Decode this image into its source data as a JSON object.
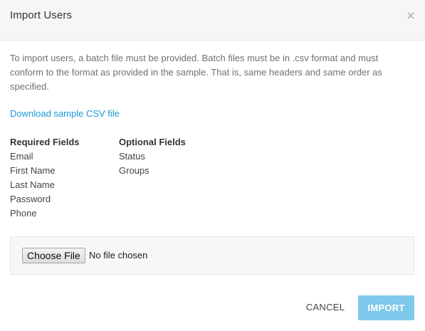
{
  "dialog": {
    "title": "Import Users",
    "close_icon": "close-icon"
  },
  "body": {
    "description": "To import users, a batch file must be provided. Batch files must be in .csv format and must conform to the format as provided in the sample. That is, same headers and same order as specified.",
    "download_link": "Download sample CSV file",
    "required_fields": {
      "heading": "Required Fields",
      "items": [
        "Email",
        "First Name",
        "Last Name",
        "Password",
        "Phone"
      ]
    },
    "optional_fields": {
      "heading": "Optional Fields",
      "items": [
        "Status",
        "Groups"
      ]
    }
  },
  "file_input": {
    "button_label": "Choose File",
    "status": "No file chosen"
  },
  "footer": {
    "cancel_label": "CANCEL",
    "import_label": "IMPORT"
  },
  "colors": {
    "link": "#1a9ad6",
    "primary_disabled": "#7ec8ec",
    "header_bg": "#f6f6f6"
  }
}
